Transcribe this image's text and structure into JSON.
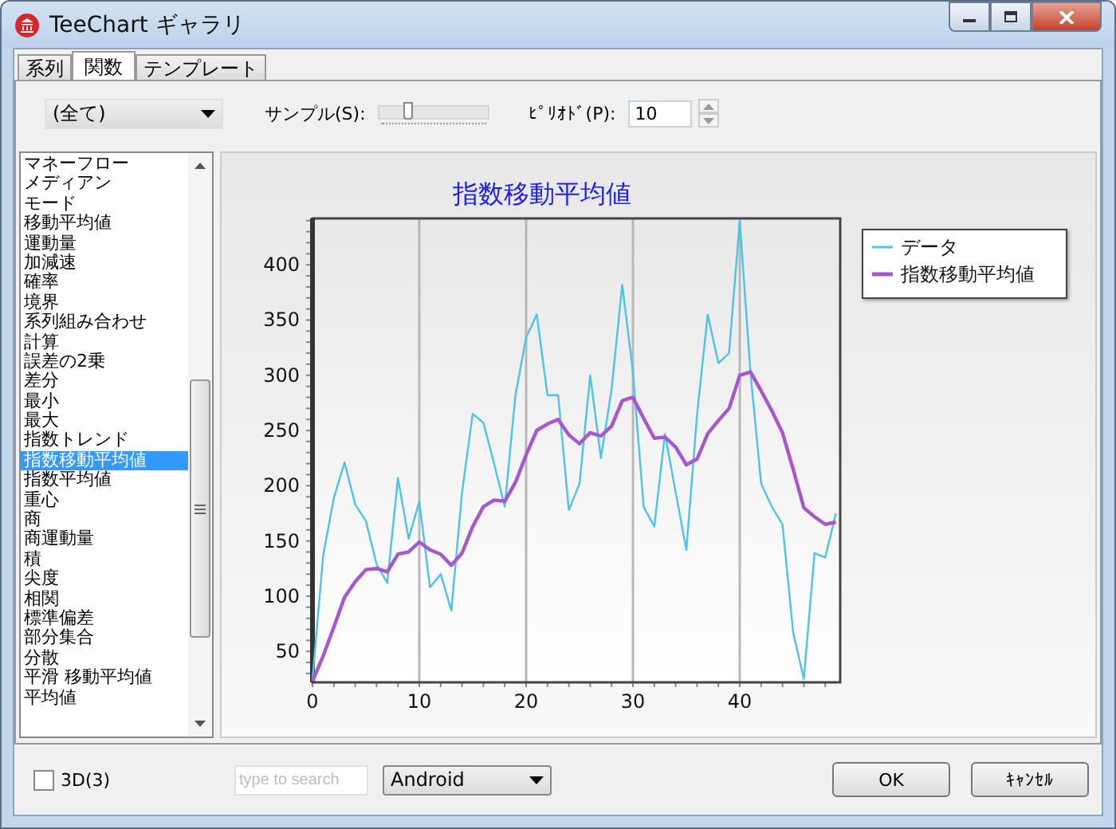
{
  "window": {
    "title": "TeeChart ギャラリ"
  },
  "tabs": [
    {
      "label": "系列",
      "selected": false
    },
    {
      "label": "関数",
      "selected": true
    },
    {
      "label": "テンプレート",
      "selected": false
    }
  ],
  "toolbar": {
    "category": "(全て)",
    "sample_label": "サンプル(S):",
    "sample": {
      "level": 0.25
    },
    "period_label": "ﾋﾟﾘｵﾄﾞ(P):",
    "period": "10"
  },
  "functions": [
    {
      "label": "マネーフロー",
      "selected": false
    },
    {
      "label": "メディアン",
      "selected": false
    },
    {
      "label": "モード",
      "selected": false
    },
    {
      "label": "移動平均値",
      "selected": false
    },
    {
      "label": "運動量",
      "selected": false
    },
    {
      "label": "加減速",
      "selected": false
    },
    {
      "label": "確率",
      "selected": false
    },
    {
      "label": "境界",
      "selected": false
    },
    {
      "label": "系列組み合わせ",
      "selected": false
    },
    {
      "label": "計算",
      "selected": false
    },
    {
      "label": "誤差の2乗",
      "selected": false
    },
    {
      "label": "差分",
      "selected": false
    },
    {
      "label": "最小",
      "selected": false
    },
    {
      "label": "最大",
      "selected": false
    },
    {
      "label": "指数トレンド",
      "selected": false
    },
    {
      "label": "指数移動平均値",
      "selected": true
    },
    {
      "label": "指数平均値",
      "selected": false
    },
    {
      "label": "重心",
      "selected": false
    },
    {
      "label": "商",
      "selected": false
    },
    {
      "label": "商運動量",
      "selected": false
    },
    {
      "label": "積",
      "selected": false
    },
    {
      "label": "尖度",
      "selected": false
    },
    {
      "label": "相関",
      "selected": false
    },
    {
      "label": "標準偏差",
      "selected": false
    },
    {
      "label": "部分集合",
      "selected": false
    },
    {
      "label": "分散",
      "selected": false
    },
    {
      "label": "平滑 移動平均値",
      "selected": false
    },
    {
      "label": "平均値",
      "selected": false
    }
  ],
  "chart": {
    "chart_data": {
      "type": "line",
      "title": "指数移動平均値",
      "grid": true,
      "legend": "right",
      "x": [
        0,
        1,
        2,
        3,
        4,
        5,
        6,
        7,
        8,
        9,
        10,
        11,
        12,
        13,
        14,
        15,
        16,
        17,
        18,
        19,
        20,
        21,
        22,
        23,
        24,
        25,
        26,
        27,
        28,
        29,
        30,
        31,
        32,
        33,
        34,
        35,
        36,
        37,
        38,
        39,
        40,
        41,
        42,
        43,
        44,
        45,
        46,
        47,
        48,
        49
      ],
      "xlim": [
        0,
        49.4
      ],
      "ylim": [
        22,
        442
      ],
      "xticks": [
        0,
        10,
        20,
        30,
        40
      ],
      "yticks": [
        50,
        100,
        150,
        200,
        250,
        300,
        350,
        400
      ],
      "series": [
        {
          "name": "データ",
          "color": "#4cc3e8",
          "values": [
            25,
            137,
            189,
            221,
            183,
            168,
            129,
            112,
            207,
            152,
            186,
            108,
            120,
            87,
            194,
            265,
            257,
            220,
            181,
            282,
            334,
            355,
            282,
            282,
            178,
            202,
            300,
            225,
            287,
            382,
            303,
            181,
            163,
            247,
            194,
            142,
            264,
            355,
            311,
            320,
            440,
            303,
            202,
            181,
            165,
            67,
            25,
            139,
            135,
            175
          ]
        },
        {
          "name": "指数移動平均値",
          "color": "#a855d0",
          "values": [
            23,
            46,
            72,
            99,
            113,
            124,
            125,
            122,
            138,
            140,
            149,
            142,
            138,
            128,
            139,
            163,
            181,
            187,
            186,
            203,
            228,
            250,
            256,
            260,
            246,
            238,
            248,
            245,
            254,
            277,
            280,
            261,
            243,
            244,
            235,
            219,
            224,
            247,
            259,
            270,
            300,
            303,
            286,
            268,
            248,
            215,
            180,
            172,
            165,
            167
          ]
        }
      ]
    }
  },
  "footer": {
    "three_d_label": "3D(3)",
    "three_d_checked": false,
    "search_placeholder": "type to search",
    "theme": "Android",
    "buttons": [
      "OK",
      "ｷｬﾝｾﾙ"
    ]
  }
}
